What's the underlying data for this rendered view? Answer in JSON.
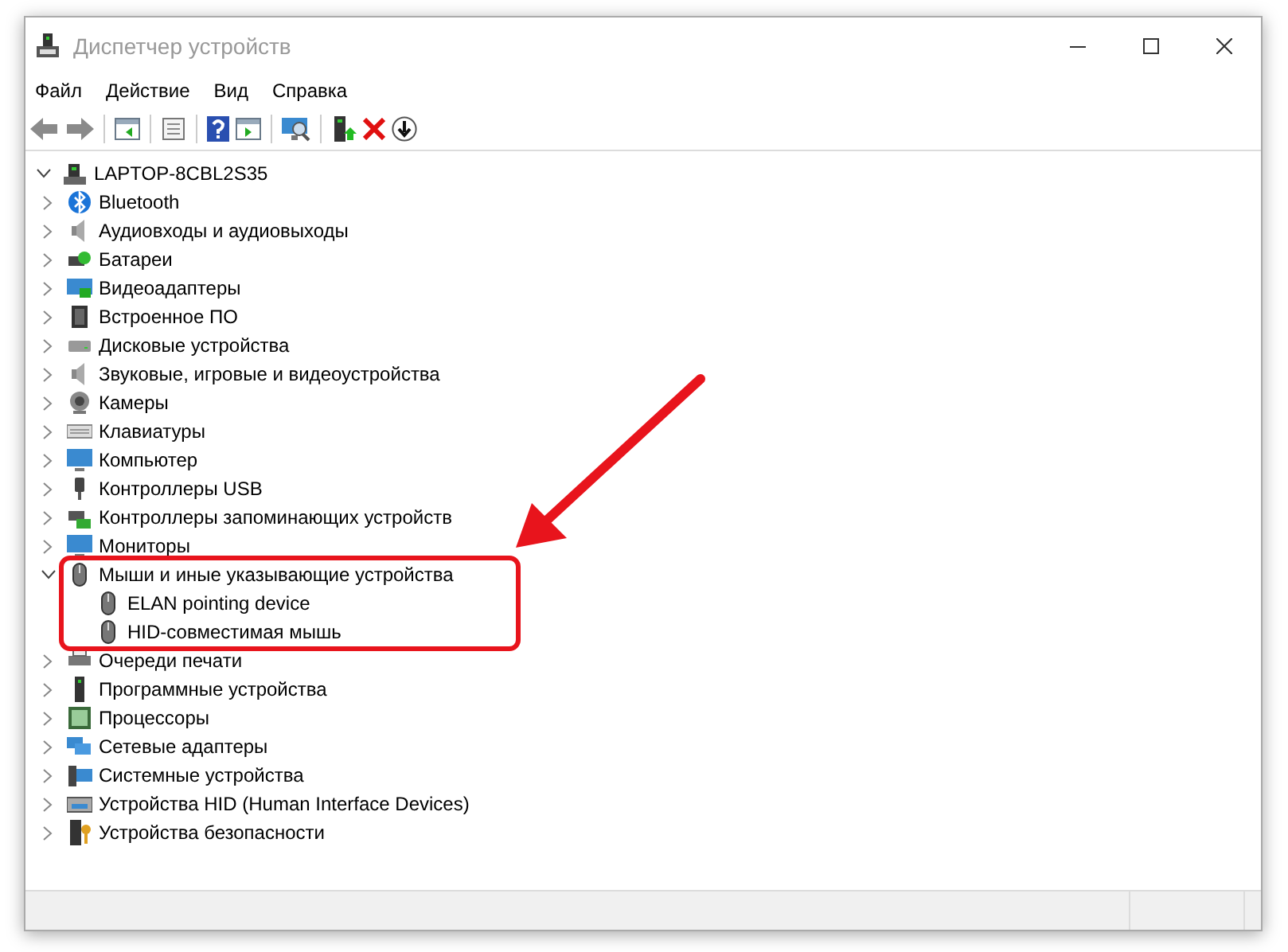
{
  "window": {
    "title": "Диспетчер устройств"
  },
  "menu": [
    "Файл",
    "Действие",
    "Вид",
    "Справка"
  ],
  "tree": {
    "label": "LAPTOP-8CBL2S35",
    "expanded": true,
    "children": [
      {
        "label": "Bluetooth",
        "expanded": false
      },
      {
        "label": "Аудиовходы и аудиовыходы",
        "expanded": false
      },
      {
        "label": "Батареи",
        "expanded": false
      },
      {
        "label": "Видеоадаптеры",
        "expanded": false
      },
      {
        "label": "Встроенное ПО",
        "expanded": false
      },
      {
        "label": "Дисковые устройства",
        "expanded": false
      },
      {
        "label": "Звуковые, игровые и видеоустройства",
        "expanded": false
      },
      {
        "label": "Камеры",
        "expanded": false
      },
      {
        "label": "Клавиатуры",
        "expanded": false
      },
      {
        "label": "Компьютер",
        "expanded": false
      },
      {
        "label": "Контроллеры USB",
        "expanded": false
      },
      {
        "label": "Контроллеры запоминающих устройств",
        "expanded": false
      },
      {
        "label": "Мониторы",
        "expanded": false
      },
      {
        "label": "Мыши и иные указывающие устройства",
        "expanded": true,
        "highlighted": true,
        "children": [
          {
            "label": "ELAN pointing device"
          },
          {
            "label": "HID-совместимая мышь"
          }
        ]
      },
      {
        "label": "Очереди печати",
        "expanded": false
      },
      {
        "label": "Программные устройства",
        "expanded": false
      },
      {
        "label": "Процессоры",
        "expanded": false
      },
      {
        "label": "Сетевые адаптеры",
        "expanded": false
      },
      {
        "label": "Системные устройства",
        "expanded": false
      },
      {
        "label": "Устройства HID (Human Interface Devices)",
        "expanded": false
      },
      {
        "label": "Устройства безопасности",
        "expanded": false
      }
    ]
  }
}
